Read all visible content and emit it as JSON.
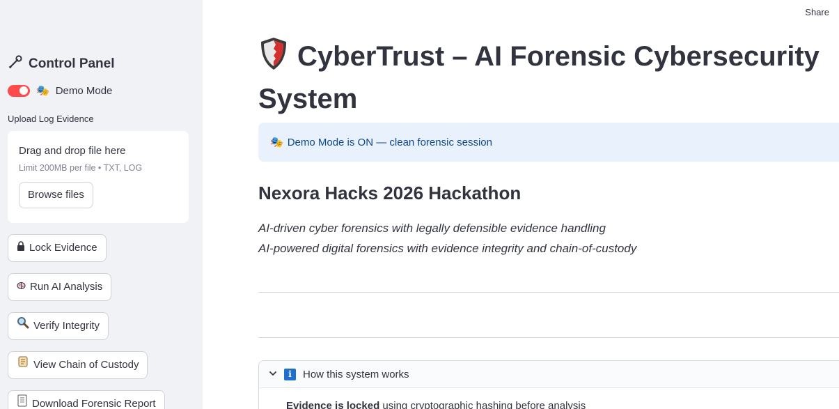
{
  "header": {
    "share_label": "Share"
  },
  "sidebar": {
    "title": "Control Panel",
    "demo_toggle": {
      "label": "Demo Mode",
      "on": true
    },
    "upload": {
      "label": "Upload Log Evidence",
      "drop_text": "Drag and drop file here",
      "limit_text": "Limit 200MB per file • TXT, LOG",
      "browse_label": "Browse files"
    },
    "buttons": [
      {
        "icon": "lock-icon",
        "label": "Lock Evidence"
      },
      {
        "icon": "brain-icon",
        "label": "Run AI Analysis"
      },
      {
        "icon": "magnifier-icon",
        "label": "Verify Integrity"
      },
      {
        "icon": "scroll-icon",
        "label": "View Chain of Custody"
      },
      {
        "icon": "report-icon",
        "label": "Download Forensic Report"
      }
    ]
  },
  "main": {
    "title": "CyberTrust – AI Forensic Cybersecurity System",
    "info_message": "Demo Mode is ON — clean forensic session",
    "hackathon_title": "Nexora Hacks 2026 Hackathon",
    "taglines": [
      "AI-driven cyber forensics with legally defensible evidence handling",
      "AI-powered digital forensics with evidence integrity and chain-of-custody"
    ],
    "expander": {
      "title": "How this system works",
      "body_bold": "Evidence is locked",
      "body_rest": " using cryptographic hashing before analysis"
    }
  },
  "colors": {
    "accent": "#ff4b4b",
    "sidebar_bg": "#f0f2f6",
    "info_bg": "#e8f1fc",
    "info_text": "#0e4a8a"
  }
}
